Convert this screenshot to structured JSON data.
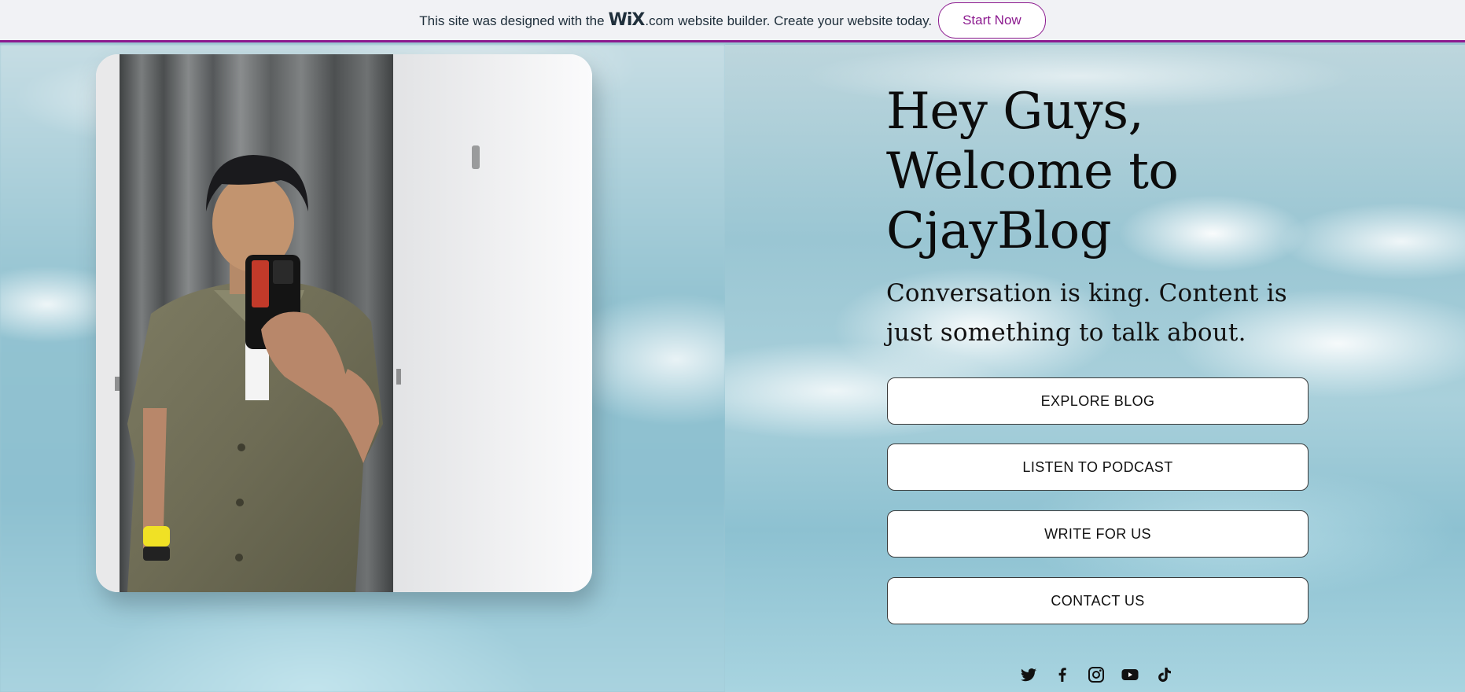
{
  "banner": {
    "text_before": "This site was designed with the",
    "logo": "WiX",
    "logo_suffix": ".com",
    "text_after": "website builder. Create your website today.",
    "cta_label": "Start Now",
    "accent_color": "#8c1a8f"
  },
  "hero": {
    "title_lines": [
      "Hey Guys,",
      "Welcome to",
      "CjayBlog"
    ],
    "subtitle_lines": [
      "Conversation is king. Content is",
      "just something to talk about."
    ]
  },
  "buttons": [
    "EXPLORE BLOG",
    "LISTEN TO PODCAST",
    "WRITE FOR US",
    "CONTACT US"
  ],
  "social": [
    "twitter-icon",
    "facebook-icon",
    "instagram-icon",
    "youtube-icon",
    "tiktok-icon"
  ],
  "photo": {
    "subject": "man-taking-mirror-selfie-photo"
  }
}
